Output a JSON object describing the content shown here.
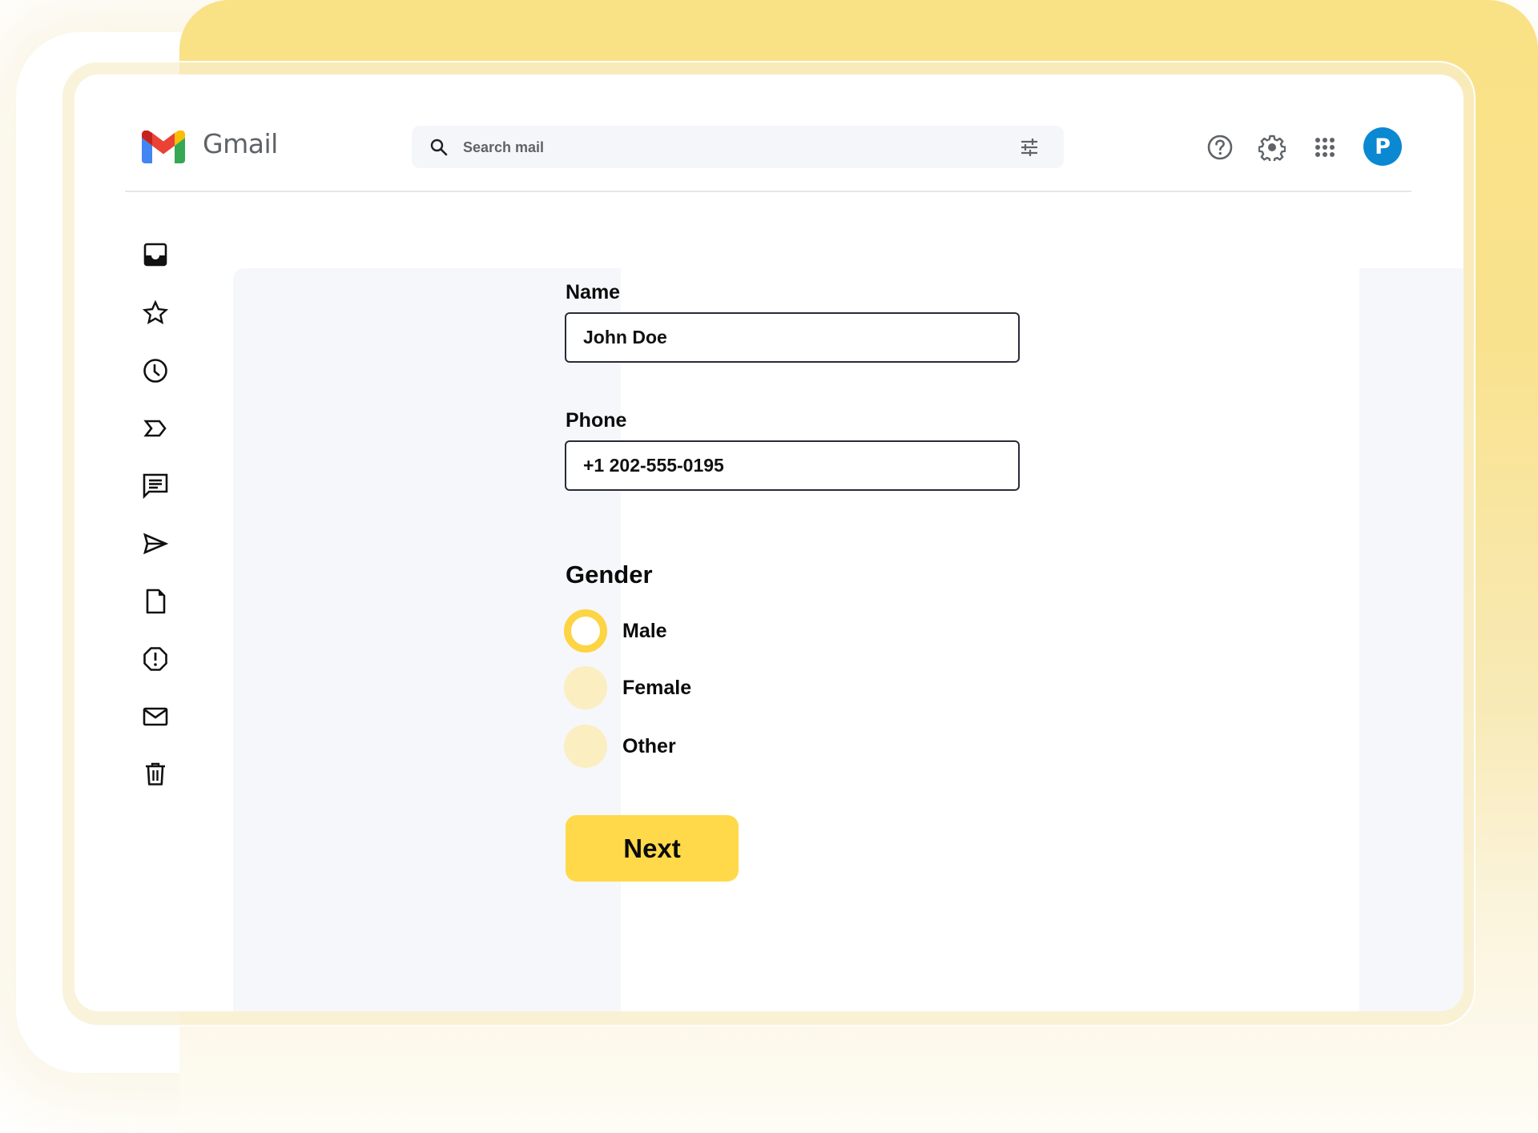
{
  "app": {
    "name": "Gmail"
  },
  "header": {
    "search": {
      "placeholder": "Search mail",
      "value": "",
      "icon": "search-icon",
      "options_icon": "tune-icon"
    },
    "actions": [
      {
        "name": "help",
        "icon": "help-circle-icon"
      },
      {
        "name": "settings",
        "icon": "gear-icon"
      },
      {
        "name": "apps",
        "icon": "apps-grid-icon"
      }
    ],
    "avatar": {
      "initial": "P",
      "color": "#0a88d2"
    }
  },
  "sidebar": {
    "items": [
      {
        "name": "inbox",
        "icon": "inbox-icon"
      },
      {
        "name": "starred",
        "icon": "star-icon"
      },
      {
        "name": "snoozed",
        "icon": "clock-icon"
      },
      {
        "name": "important",
        "icon": "label-important-icon"
      },
      {
        "name": "chats",
        "icon": "chat-icon"
      },
      {
        "name": "sent",
        "icon": "send-icon"
      },
      {
        "name": "drafts",
        "icon": "draft-icon"
      },
      {
        "name": "spam",
        "icon": "spam-icon"
      },
      {
        "name": "all-mail",
        "icon": "mail-icon"
      },
      {
        "name": "trash",
        "icon": "trash-icon"
      }
    ]
  },
  "form": {
    "name": {
      "label": "Name",
      "value": "John Doe"
    },
    "phone": {
      "label": "Phone",
      "value": "+1 202-555-0195"
    },
    "gender": {
      "label": "Gender",
      "options": [
        {
          "label": "Male",
          "selected": true
        },
        {
          "label": "Female",
          "selected": false
        },
        {
          "label": "Other",
          "selected": false
        }
      ]
    },
    "submit_label": "Next"
  },
  "colors": {
    "accent_yellow": "#ffd94a",
    "radio_ring": "#fdd443",
    "radio_inactive": "#fbeec0",
    "avatar_blue": "#0a88d2"
  }
}
